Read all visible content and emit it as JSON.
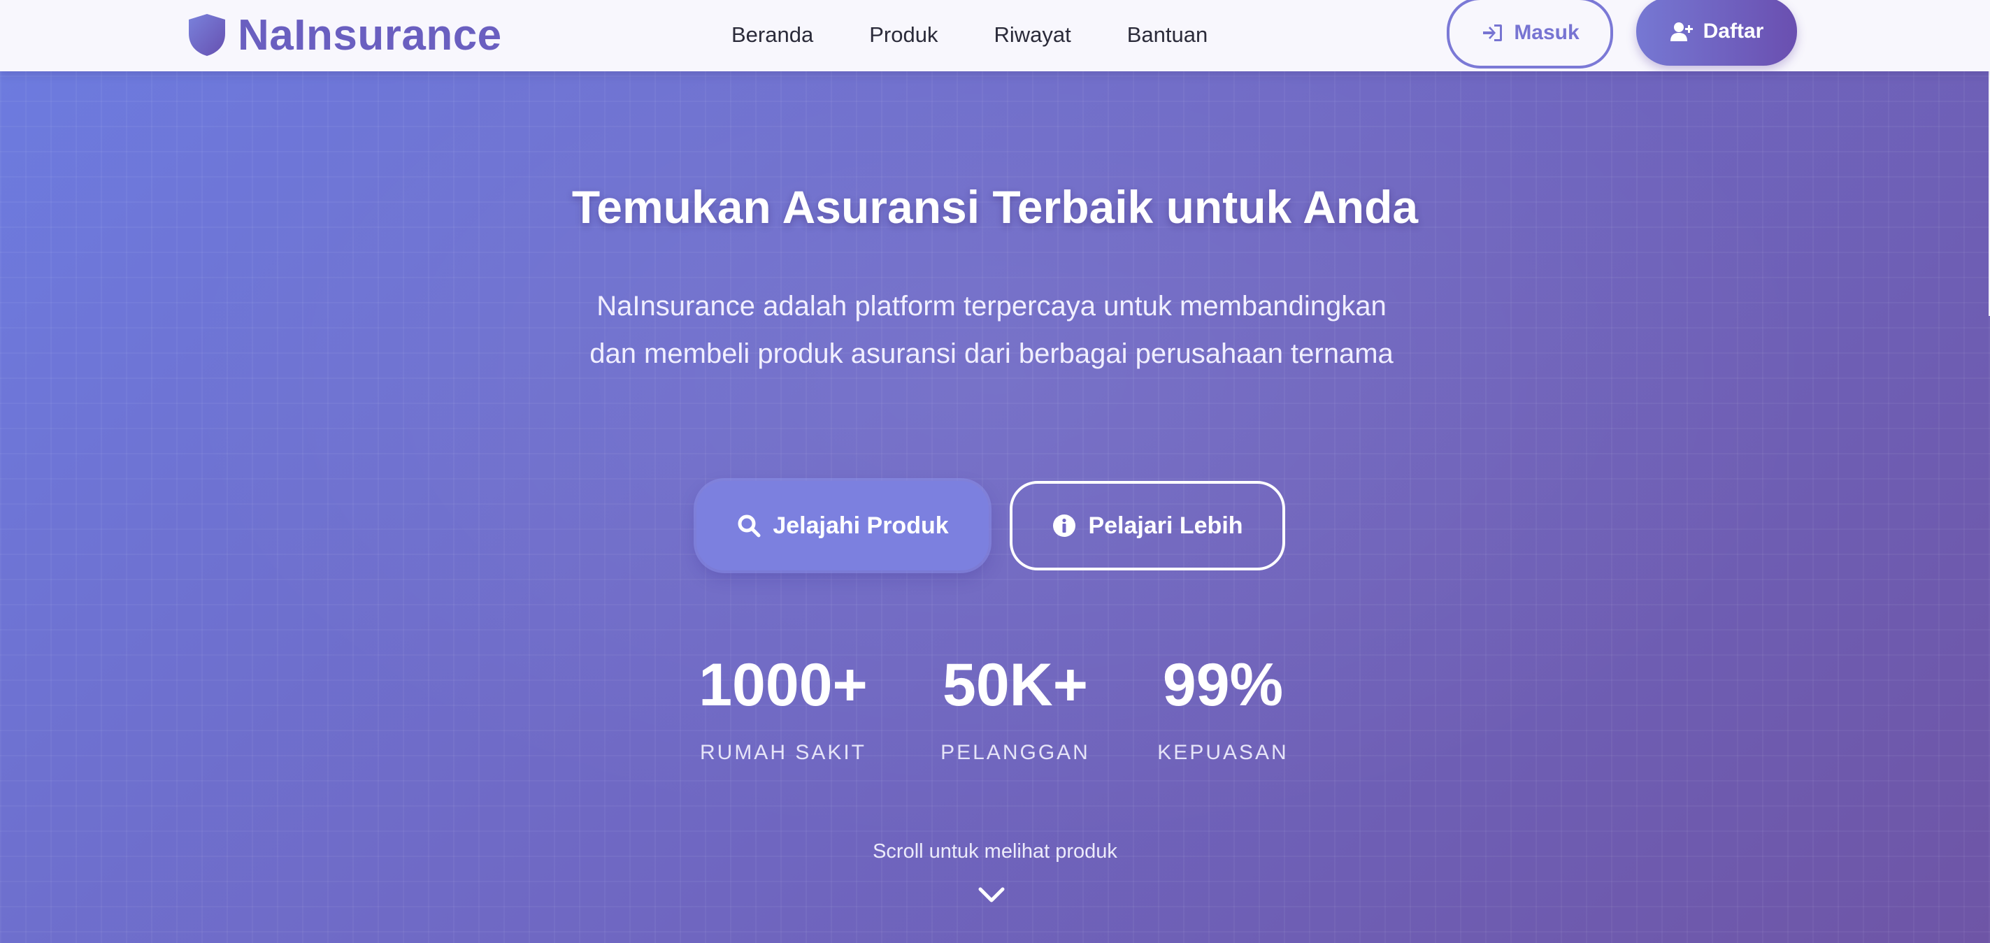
{
  "brand": {
    "name": "NaInsurance"
  },
  "nav": {
    "links": [
      "Beranda",
      "Produk",
      "Riwayat",
      "Bantuan"
    ],
    "login_label": "Masuk",
    "register_label": "Daftar"
  },
  "hero": {
    "title": "Temukan Asuransi Terbaik untuk Anda",
    "description": "NaInsurance adalah platform terpercaya untuk membandingkan dan membeli produk asuransi dari berbagai perusahaan ternama",
    "primary_cta": "Jelajahi Produk",
    "secondary_cta": "Pelajari Lebih",
    "stats": [
      {
        "value": "1000+",
        "label": "RUMAH SAKIT"
      },
      {
        "value": "50K+",
        "label": "PELANGGAN"
      },
      {
        "value": "99%",
        "label": "KEPUASAN"
      }
    ],
    "scroll_hint": "Scroll untuk melihat produk"
  },
  "icons": {
    "brand": "shield-icon",
    "login": "sign-in-icon",
    "register": "user-plus-icon",
    "explore": "search-icon",
    "learn": "info-circle-icon",
    "scroll": "chevron-down-icon"
  },
  "colors": {
    "brand": "#6a5fc0",
    "gradient_start": "#6d7ce0",
    "gradient_end": "#6e55a6",
    "nav_bg": "#f8f7fd"
  }
}
